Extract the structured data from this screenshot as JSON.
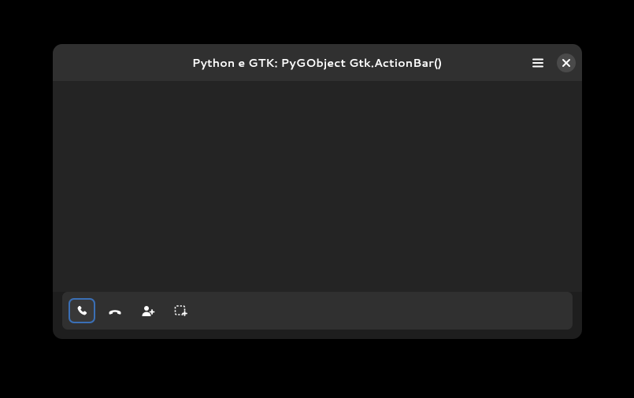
{
  "header": {
    "title": "Python e GTK: PyGObject Gtk.ActionBar()",
    "menu_icon": "menu-icon",
    "close_icon": "close-icon"
  },
  "actionbar": {
    "items": [
      {
        "name": "call-start-icon",
        "active": true
      },
      {
        "name": "call-stop-icon",
        "active": false
      },
      {
        "name": "contact-new-icon",
        "active": false
      },
      {
        "name": "tab-new-icon",
        "active": false
      }
    ]
  },
  "colors": {
    "window_bg": "#1e1e1e",
    "content_bg": "#242424",
    "bar_bg": "#303030",
    "focus_ring": "#3a6fb5"
  }
}
